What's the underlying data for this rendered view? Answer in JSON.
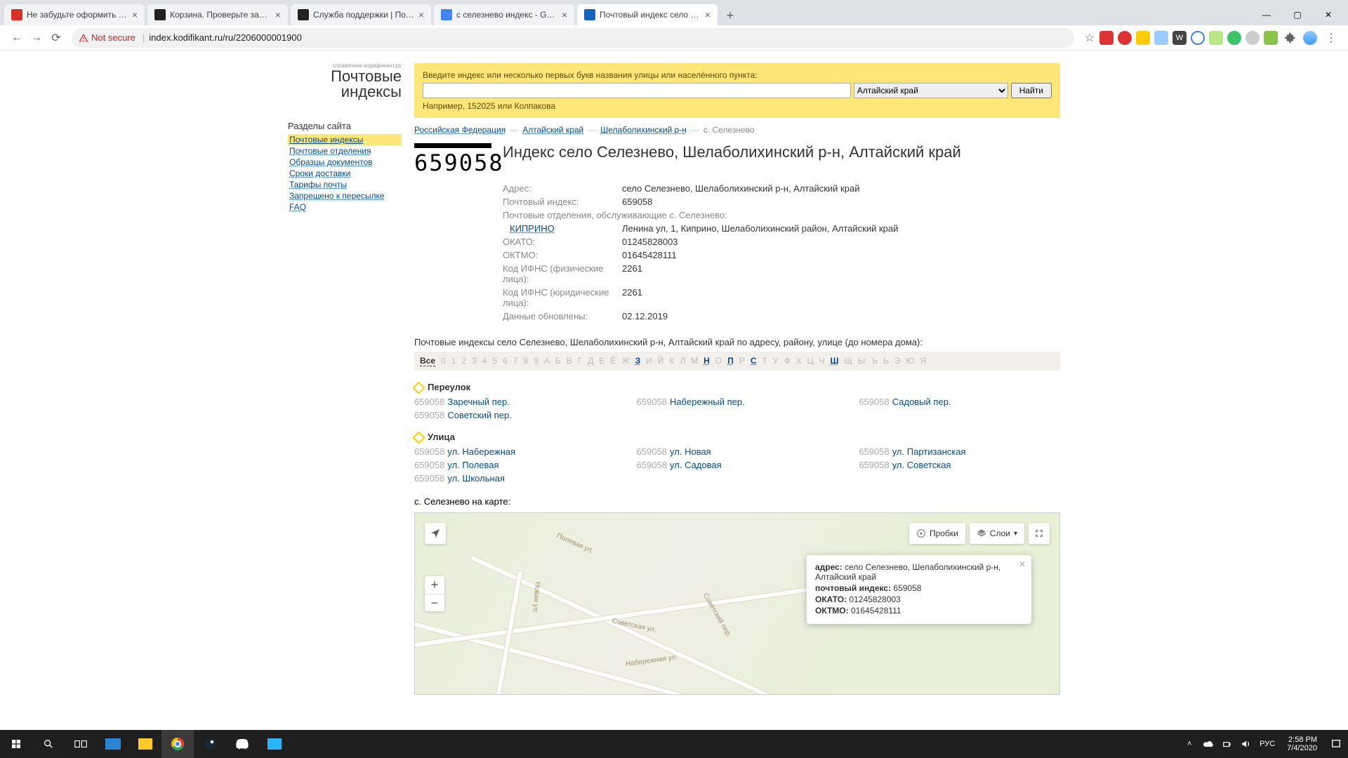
{
  "tabs": [
    {
      "title": "Не забудьте оформить заказ - c",
      "fav": "#d93025"
    },
    {
      "title": "Корзина. Проверьте заказ. Инт",
      "fav": "#222"
    },
    {
      "title": "Служба поддержки | Поддерж",
      "fav": "#222"
    },
    {
      "title": "с селезнево индекс - Google Se",
      "fav": "#4285f4"
    },
    {
      "title": "Почтовый индекс село Селезне",
      "fav": "#1565c0",
      "active": true
    }
  ],
  "url": "index.kodifikant.ru/ru/2206000001900",
  "notsecure": "Not secure",
  "logo": {
    "small": "справочник кодификант.ру",
    "big": "Почтовые индексы"
  },
  "nav": {
    "header": "Разделы сайта",
    "items": [
      {
        "t": "Почтовые индексы",
        "sel": true
      },
      {
        "t": "Почтовые отделения"
      },
      {
        "t": "Образцы документов"
      },
      {
        "t": "Сроки доставки"
      },
      {
        "t": "Тарифы почты"
      },
      {
        "t": "Запрещено к пересылке"
      },
      {
        "t": "FAQ"
      }
    ]
  },
  "search": {
    "label": "Введите индекс или несколько первых букв названия улицы или населённого пункта:",
    "region": "Алтайский край",
    "btn": "Найти",
    "example": "Например, 152025 или Колпакова"
  },
  "crumbs": [
    {
      "t": "Российская Федерация",
      "link": true
    },
    {
      "t": "Алтайский край",
      "link": true
    },
    {
      "t": "Шелаболихинский р-н",
      "link": true
    },
    {
      "t": "с. Селезнево",
      "link": false
    }
  ],
  "stamp": "659058",
  "h1": "Индекс село Селезнево, Шелаболихинский р-н, Алтайский край",
  "info": [
    {
      "k": "Адрес:",
      "v": "село Селезнево, Шелаболихинский р-н, Алтайский край"
    },
    {
      "k": "Почтовый индекс:",
      "v": "659058"
    }
  ],
  "office_line": "Почтовые отделения, обслуживающие с. Селезнево:",
  "office": {
    "name": "КИПРИНО",
    "addr": "Ленина ул, 1, Киприно, Шелаболихинский район, Алтайский край"
  },
  "info2": [
    {
      "k": "ОКАТО:",
      "v": "01245828003"
    },
    {
      "k": "ОКТМО:",
      "v": "01645428111"
    },
    {
      "k": "Код ИФНС (физические лица):",
      "v": "2261"
    },
    {
      "k": "Код ИФНС (юридические лица):",
      "v": "2261"
    },
    {
      "k": "Данные обновлены:",
      "v": "02.12.2019"
    }
  ],
  "subtitle": "Почтовые индексы село Селезнево, Шелаболихинский р-н, Алтайский край по адресу, району, улице (до номера дома):",
  "alpha": {
    "all": "Все",
    "letters": [
      "0",
      "1",
      "2",
      "3",
      "4",
      "5",
      "6",
      "7",
      "8",
      "9",
      "А",
      "Б",
      "В",
      "Г",
      "Д",
      "Е",
      "Ё",
      "Ж",
      "З",
      "И",
      "Й",
      "К",
      "Л",
      "М",
      "Н",
      "О",
      "П",
      "Р",
      "С",
      "Т",
      "У",
      "Ф",
      "Х",
      "Ц",
      "Ч",
      "Ш",
      "Щ",
      "Ы",
      "Ъ",
      "Ь",
      "Э",
      "Ю",
      "Я"
    ],
    "active": [
      "З",
      "Н",
      "П",
      "С",
      "Ш"
    ]
  },
  "groups": [
    {
      "name": "Переулок",
      "items": [
        {
          "idx": "659058",
          "nm": "Заречный пер."
        },
        {
          "idx": "659058",
          "nm": "Набережный пер."
        },
        {
          "idx": "659058",
          "nm": "Садовый пер."
        },
        {
          "idx": "659058",
          "nm": "Советский пер."
        }
      ]
    },
    {
      "name": "Улица",
      "items": [
        {
          "idx": "659058",
          "nm": "ул. Набережная"
        },
        {
          "idx": "659058",
          "nm": "ул. Новая"
        },
        {
          "idx": "659058",
          "nm": "ул. Партизанская"
        },
        {
          "idx": "659058",
          "nm": "ул. Полевая"
        },
        {
          "idx": "659058",
          "nm": "ул. Садовая"
        },
        {
          "idx": "659058",
          "nm": "ул. Советская"
        },
        {
          "idx": "659058",
          "nm": "ул. Школьная"
        }
      ]
    }
  ],
  "maplabel": "с. Селезнево на карте:",
  "map": {
    "traffic": "Пробки",
    "layers": "Слои",
    "roads": [
      "Полевая ул.",
      "Новая ул.",
      "Советская ул.",
      "Советский пер.",
      "Набережная ул."
    ],
    "pop": {
      "l1": {
        "k": "адрес:",
        "v": "село Селезнево, Шелаболихинский р-н, Алтайский край"
      },
      "l2": {
        "k": "почтовый индекс:",
        "v": "659058"
      },
      "l3": {
        "k": "ОКАТО:",
        "v": "01245828003"
      },
      "l4": {
        "k": "ОКТМО:",
        "v": "01645428111"
      }
    }
  },
  "taskbar": {
    "lang": "РУС",
    "time": "2:58 PM",
    "date": "7/4/2020"
  }
}
